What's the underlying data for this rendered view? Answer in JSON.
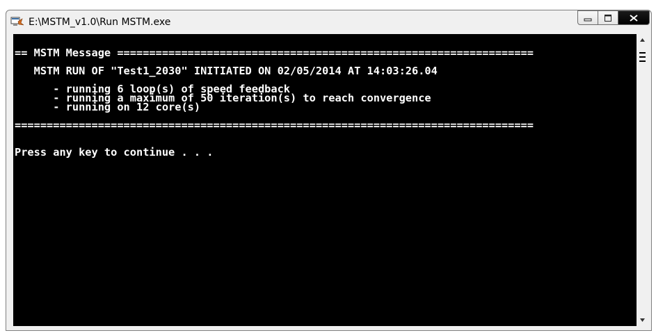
{
  "window": {
    "title": "E:\\MSTM_v1.0\\Run MSTM.exe"
  },
  "icons": {
    "app": "console-app-icon",
    "minimize": "minimize-icon",
    "maximize": "maximize-icon",
    "close": "close-icon",
    "scroll_up": "arrow-up-icon",
    "scroll_down": "arrow-down-icon"
  },
  "console": {
    "lines": [
      "",
      "== MSTM Message =================================================================",
      "",
      "   MSTM RUN OF \"Test1_2030\" INITIATED ON 02/05/2014 AT 14:03:26.04",
      "",
      "      - running 6 loop(s) of speed feedback",
      "      - running a maximum of 50 iteration(s) to reach convergence",
      "      - running on 12 core(s)",
      "",
      "=================================================================================",
      "",
      "",
      "Press any key to continue . . ."
    ]
  },
  "colors": {
    "console_bg": "#000000",
    "console_fg": "#ffffff",
    "frame": "#f0f0f0"
  }
}
